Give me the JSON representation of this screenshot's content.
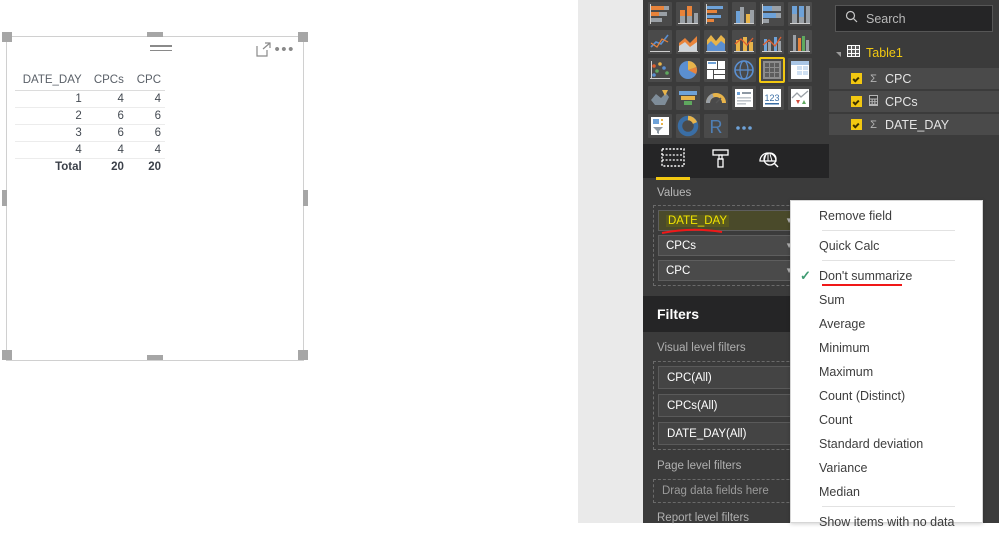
{
  "visual": {
    "name": "table-visual",
    "header_icons": [
      "drag-handle-icon",
      "focus-mode-icon",
      "more-options-icon"
    ],
    "columns": [
      "DATE_DAY",
      "CPCs",
      "CPC"
    ],
    "rows": [
      [
        "1",
        "4",
        "4"
      ],
      [
        "2",
        "6",
        "6"
      ],
      [
        "3",
        "6",
        "6"
      ],
      [
        "4",
        "4",
        "4"
      ]
    ],
    "total_row": [
      "Total",
      "20",
      "20"
    ]
  },
  "viz_pane": {
    "tabs": [
      {
        "name": "fields-tab",
        "icon": "fields-table-icon",
        "active": true
      },
      {
        "name": "format-tab",
        "icon": "paint-roller-icon",
        "active": false
      },
      {
        "name": "analytics-tab",
        "icon": "magnifier-chart-icon",
        "active": false
      }
    ],
    "gallery_icons": [
      "stacked-bar-chart-icon",
      "stacked-column-chart-icon",
      "clustered-bar-chart-icon",
      "clustered-column-chart-icon",
      "100-stacked-bar-chart-icon",
      "100-stacked-column-chart-icon",
      "line-chart-icon",
      "area-chart-icon",
      "stacked-area-chart-icon",
      "line-stacked-column-chart-icon",
      "line-clustered-column-chart-icon",
      "ribbon-chart-icon",
      "scatter-chart-icon",
      "pie-chart-icon",
      "treemap-icon",
      "map-icon",
      "table-icon",
      "matrix-icon",
      "filled-map-icon",
      "funnel-chart-icon",
      "gauge-chart-icon",
      "multi-row-card-icon",
      "card-icon",
      "kpi-icon",
      "slicer-icon",
      "donut-chart-icon",
      "r-script-visual-icon",
      "more-visuals-icon"
    ],
    "selected_gallery_icon": "table-icon",
    "values_label": "Values",
    "value_fields": [
      {
        "label": "DATE_DAY",
        "highlighted": true,
        "has_close": true,
        "annotation": "red-underline"
      },
      {
        "label": "CPCs",
        "highlighted": false,
        "has_close": false
      },
      {
        "label": "CPC",
        "highlighted": false,
        "has_close": false
      }
    ],
    "filters_title": "Filters",
    "visual_level_filters_label": "Visual level filters",
    "visual_level_filters": [
      "CPC(All)",
      "CPCs(All)",
      "DATE_DAY(All)"
    ],
    "page_level_filters_label": "Page level filters",
    "page_level_drop_hint": "Drag data fields here",
    "report_level_filters_label": "Report level filters"
  },
  "fields_pane": {
    "search_placeholder": "Search",
    "search_icon": "search-icon",
    "table_name": "Table1",
    "table_icon": "table-grid-icon",
    "fields": [
      {
        "label": "CPC",
        "checked": true,
        "type_icon": "sigma-icon"
      },
      {
        "label": "CPCs",
        "checked": true,
        "type_icon": "measure-calculator-icon"
      },
      {
        "label": "DATE_DAY",
        "checked": true,
        "type_icon": "sigma-icon"
      }
    ]
  },
  "context_menu": {
    "items": [
      {
        "label": "Remove field",
        "checked": false,
        "sep_after": true,
        "underline": false
      },
      {
        "label": "Quick Calc",
        "checked": false,
        "sep_after": true,
        "underline": false
      },
      {
        "label": "Don't summarize",
        "checked": true,
        "sep_after": false,
        "underline": true
      },
      {
        "label": "Sum",
        "checked": false,
        "sep_after": false,
        "underline": false
      },
      {
        "label": "Average",
        "checked": false,
        "sep_after": false,
        "underline": false
      },
      {
        "label": "Minimum",
        "checked": false,
        "sep_after": false,
        "underline": false
      },
      {
        "label": "Maximum",
        "checked": false,
        "sep_after": false,
        "underline": false
      },
      {
        "label": "Count (Distinct)",
        "checked": false,
        "sep_after": false,
        "underline": false
      },
      {
        "label": "Count",
        "checked": false,
        "sep_after": false,
        "underline": false
      },
      {
        "label": "Standard deviation",
        "checked": false,
        "sep_after": false,
        "underline": false
      },
      {
        "label": "Variance",
        "checked": false,
        "sep_after": false,
        "underline": false
      },
      {
        "label": "Median",
        "checked": false,
        "sep_after": true,
        "underline": false
      },
      {
        "label": "Show items with no data",
        "checked": false,
        "sep_after": false,
        "underline": false
      }
    ],
    "check_glyph": "✓"
  },
  "colors": {
    "accent_yellow": "#f2c811",
    "panel_dark": "#3b3b3b",
    "panel_darker": "#252526",
    "annotation_red": "#f01818",
    "check_green": "#3f9b72",
    "canvas_gray": "#eaeaea"
  }
}
